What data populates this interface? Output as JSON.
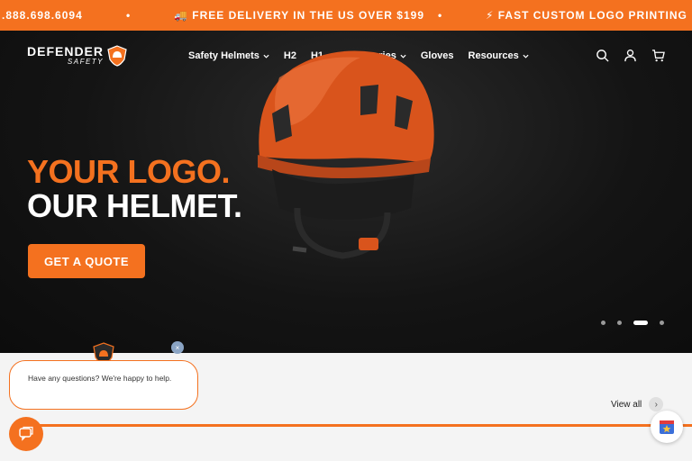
{
  "announcement": {
    "phone": ".888.698.6094",
    "sep1": "•",
    "delivery": "🚚 FREE DELIVERY IN THE US OVER $199",
    "sep2": "•",
    "logo_printing": "⚡ FAST CUSTOM LOGO PRINTING"
  },
  "brand": {
    "name": "DEFENDER",
    "sub": "SAFETY"
  },
  "nav": {
    "items": [
      {
        "label": "Safety Helmets",
        "dropdown": true
      },
      {
        "label": "H2",
        "dropdown": false
      },
      {
        "label": "H1",
        "dropdown": false
      },
      {
        "label": "Accessories",
        "dropdown": true
      },
      {
        "label": "Gloves",
        "dropdown": false
      },
      {
        "label": "Resources",
        "dropdown": true
      }
    ],
    "icons": [
      "search-icon",
      "account-icon",
      "cart-icon"
    ]
  },
  "hero": {
    "line1": "YOUR LOGO.",
    "line2": "OUR HELMET.",
    "cta": "GET A QUOTE",
    "slides": 4,
    "active_slide": 3
  },
  "section": {
    "view_all": "View all",
    "arrow": "›"
  },
  "chat": {
    "message": "Have any questions? We're happy to help.",
    "close": "×"
  },
  "colors": {
    "accent": "#f4711f",
    "hero_bg": "#111111"
  }
}
